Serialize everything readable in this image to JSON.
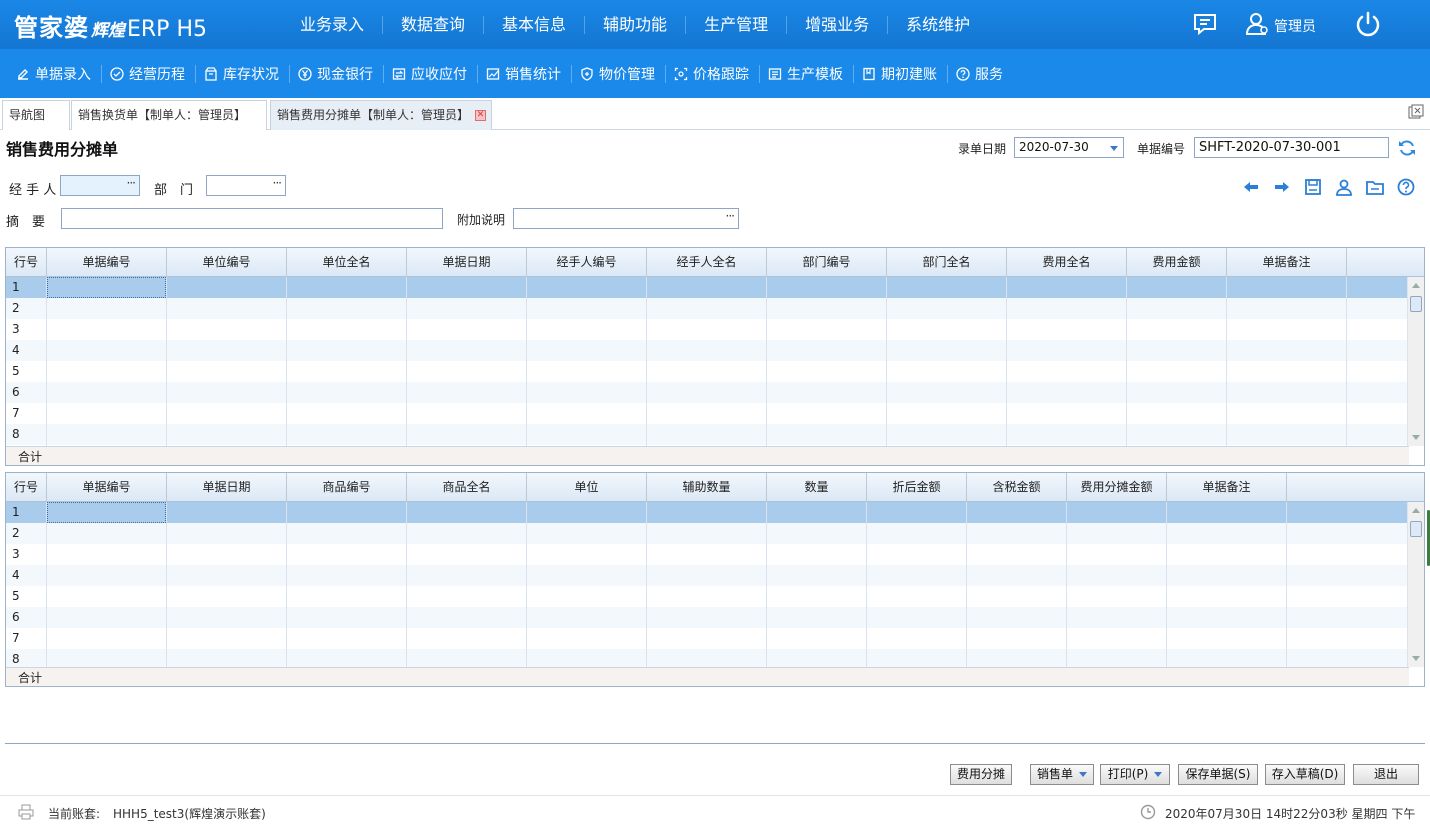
{
  "app": {
    "logo_main": "管家婆",
    "logo_sub": "辉煌",
    "logo_product": "ERP H5",
    "user_name": "管理员"
  },
  "main_nav": [
    "业务录入",
    "数据查询",
    "基本信息",
    "辅助功能",
    "生产管理",
    "增强业务",
    "系统维护"
  ],
  "sub_nav": [
    {
      "label": "单据录入",
      "icon": "edit-icon"
    },
    {
      "label": "经营历程",
      "icon": "check-circle-icon"
    },
    {
      "label": "库存状况",
      "icon": "box-icon"
    },
    {
      "label": "现金银行",
      "icon": "yen-icon"
    },
    {
      "label": "应收应付",
      "icon": "transfer-icon"
    },
    {
      "label": "销售统计",
      "icon": "chart-icon"
    },
    {
      "label": "物价管理",
      "icon": "shield-icon"
    },
    {
      "label": "价格跟踪",
      "icon": "track-icon"
    },
    {
      "label": "生产模板",
      "icon": "template-icon"
    },
    {
      "label": "期初建账",
      "icon": "book-icon"
    },
    {
      "label": "服务",
      "icon": "help-icon"
    }
  ],
  "tabs": [
    {
      "label": "导航图"
    },
    {
      "label": "销售换货单【制单人：管理员】"
    },
    {
      "label": "销售费用分摊单【制单人：管理员】"
    }
  ],
  "form": {
    "title": "销售费用分摊单",
    "date_label": "录单日期",
    "date_value": "2020-07-30",
    "number_label": "单据编号",
    "number_value": "SHFT-2020-07-30-001",
    "handler_label": "经 手 人",
    "handler_value": "",
    "dept_label": "部　门",
    "dept_value": "",
    "summary_label": "摘　要",
    "summary_value": "",
    "extra_label": "附加说明",
    "extra_value": ""
  },
  "grid1": {
    "headers": [
      "行号",
      "单据编号",
      "单位编号",
      "单位全名",
      "单据日期",
      "经手人编号",
      "经手人全名",
      "部门编号",
      "部门全名",
      "费用全名",
      "费用金额",
      "单据备注"
    ],
    "rows": [
      "1",
      "2",
      "3",
      "4",
      "5",
      "6",
      "7",
      "8"
    ],
    "footer": "合计"
  },
  "grid2": {
    "headers": [
      "行号",
      "单据编号",
      "单据日期",
      "商品编号",
      "商品全名",
      "单位",
      "辅助数量",
      "数量",
      "折后金额",
      "含税金额",
      "费用分摊金额",
      "单据备注"
    ],
    "rows": [
      "1",
      "2",
      "3",
      "4",
      "5",
      "6",
      "7",
      "8"
    ],
    "footer": "合计"
  },
  "buttons": {
    "allocate": "费用分摊",
    "sales_order": "销售单",
    "print": "打印(P)",
    "save": "保存单据(S)",
    "draft": "存入草稿(D)",
    "exit": "退出"
  },
  "status": {
    "account_label": "当前账套:",
    "account_value": "HHH5_test3(辉煌演示账套)",
    "datetime": "2020年07月30日 14时22分03秒 星期四 下午"
  }
}
